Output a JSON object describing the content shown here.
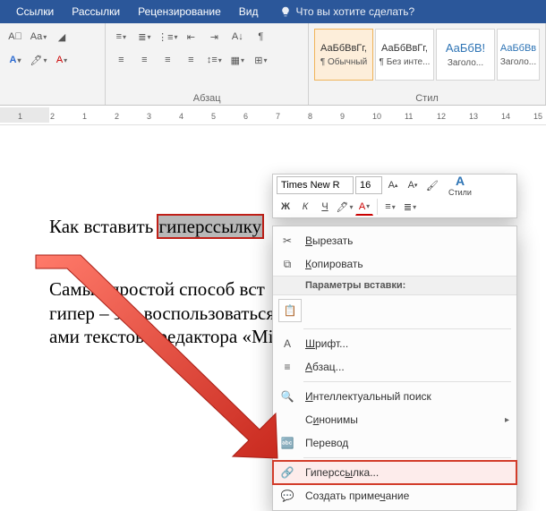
{
  "tabs": {
    "links": "Ссылки",
    "mailings": "Рассылки",
    "review": "Рецензирование",
    "view": "Вид",
    "tellme": "Что вы хотите сделать?"
  },
  "ribbon": {
    "paragraph_label": "Абзац",
    "styles_label": "Стил"
  },
  "styles": [
    {
      "sample": "АаБбВвГг,",
      "name": "¶ Обычный"
    },
    {
      "sample": "АаБбВвГг,",
      "name": "¶ Без инте..."
    },
    {
      "sample": "АаБбВ!",
      "name": "Заголо..."
    },
    {
      "sample": "АаБбВв",
      "name": "Заголо..."
    }
  ],
  "ruler_marks": [
    "1",
    "2",
    "1",
    "2",
    "3",
    "4",
    "5",
    "6",
    "7",
    "8",
    "9",
    "10",
    "11",
    "12",
    "13",
    "14",
    "15"
  ],
  "document": {
    "line1_prefix": "Как вставить ",
    "line1_selected": "гиперссылку",
    "para2": "Самый простой способ вст                                        кумент гипер – это воспользоваться встр                                        ами текстово редактора «Microsoft Word"
  },
  "minitb": {
    "font": "Times New R",
    "size": "16",
    "styles_label": "Стили"
  },
  "ctx": {
    "cut": "Вырезать",
    "copy": "Копировать",
    "paste_opts": "Параметры вставки:",
    "font": "Шрифт...",
    "paragraph": "Абзац...",
    "research": "Интеллектуальный поиск",
    "synonyms": "Синонимы",
    "translate": "Перевод",
    "hyperlink": "Гиперссылка...",
    "comment": "Создать примечание"
  }
}
